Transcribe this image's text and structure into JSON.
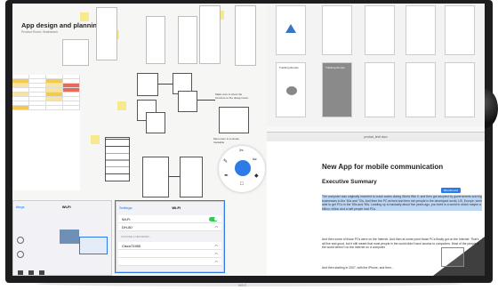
{
  "brand": "NEC",
  "board": {
    "title": "App design and planning",
    "subtitle": "Product Room, Brainstorm",
    "note1": "Make sure to show the structure to the design team",
    "note2": "Menu item is a simple trackable"
  },
  "phones": {
    "left": {
      "back": "ttings",
      "title": "Wi-Fi"
    },
    "right": {
      "back": "Settings",
      "title": "Wi-Fi",
      "rows": [
        "Wi-Fi",
        "DH-50",
        "CHOOSE A NETWORK...",
        "Cisco72450",
        "",
        ""
      ]
    }
  },
  "thumbs": {
    "labels": [
      "Tracking Routes",
      "Tracking Routes"
    ]
  },
  "doc": {
    "window_title": "product_brief.docx",
    "heading": "New App for mobile communication",
    "subheading": "Executive Summary",
    "tag": "Bloodhound",
    "p1": "The computer was originally invented to crack codes during World War II, and then got adopted by governments and big businesses in the '60s and '70s. And then the PC arrived and then rich people in the developed world, US, Europe, were able to get PCs in the '80s and '90s. Leading up to basically about five years ago, you lived in a world in which maybe a billion, billion and a half people had PCs.",
    "p2": "And then some of those PCs were on the Internet. And then at some point those PCs finally got on the Internet. That's all fine and good, but it still meant that most people in the world didn't have access to computers. Most of the people in the world weren't on the Internet on a computer.",
    "p3": "And then starting in 2007, with the iPhone, and then..."
  },
  "colors": {
    "accent": "#2d7be6",
    "sticky": "#f7e98e",
    "toggle": "#34c759",
    "bezel": "#1d1d1f"
  }
}
